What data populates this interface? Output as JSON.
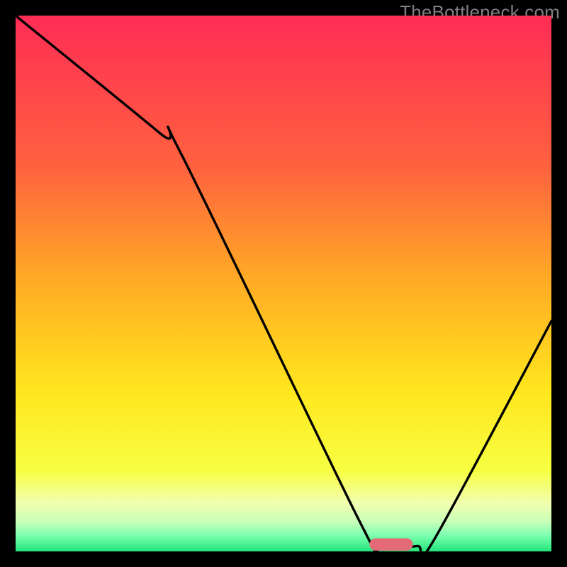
{
  "watermark": "TheBottleneck.com",
  "chart_data": {
    "type": "line",
    "title": "",
    "xlabel": "",
    "ylabel": "",
    "xlim": [
      0,
      100
    ],
    "ylim": [
      0,
      100
    ],
    "background_gradient_stops": [
      {
        "offset": 0.0,
        "color": "#ff2d55"
      },
      {
        "offset": 0.28,
        "color": "#ff613f"
      },
      {
        "offset": 0.5,
        "color": "#ffad24"
      },
      {
        "offset": 0.7,
        "color": "#ffe61e"
      },
      {
        "offset": 0.85,
        "color": "#f7ff43"
      },
      {
        "offset": 0.91,
        "color": "#f2ffb0"
      },
      {
        "offset": 0.945,
        "color": "#c8ffb8"
      },
      {
        "offset": 0.97,
        "color": "#7dffb0"
      },
      {
        "offset": 1.0,
        "color": "#22e57a"
      }
    ],
    "curve": {
      "x": [
        0.0,
        27.0,
        31.0,
        64.0,
        68.0,
        75.0,
        78.0,
        100.0
      ],
      "y": [
        100.0,
        78.0,
        74.0,
        6.0,
        1.0,
        1.0,
        2.0,
        43.0
      ]
    },
    "marker": {
      "x_start": 67.2,
      "x_end": 73.0,
      "y": 1.3,
      "color": "#e46a77",
      "thickness": 2.3
    }
  }
}
